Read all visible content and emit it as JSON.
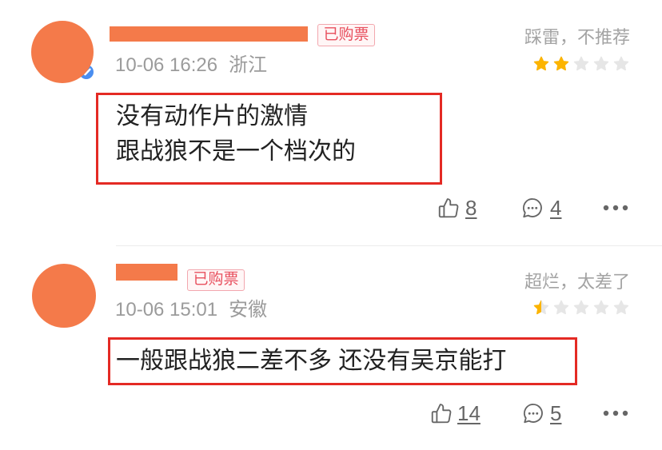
{
  "icons": {
    "verified": "verified-check-icon",
    "like": "thumbs-up-icon",
    "reply": "comment-bubble-icon",
    "more": "more-dots-icon",
    "star": "star-icon"
  },
  "colors": {
    "redaction": "#f47a4a",
    "highlight_border": "#e42a24",
    "badge_text": "#e8505e",
    "star_filled": "#fcb400",
    "star_empty": "#e6e6e6",
    "verified": "#4a8ef0",
    "muted_text": "#9b9b9b"
  },
  "comments": [
    {
      "verified": true,
      "badge": "已购票",
      "verdict": "踩雷，不推荐",
      "rating": 2,
      "rating_max": 5,
      "date": "10-06 16:26",
      "location": "浙江",
      "text_lines": [
        "没有动作片的激情",
        "跟战狼不是一个档次的"
      ],
      "likes": "8",
      "replies": "4"
    },
    {
      "verified": false,
      "badge": "已购票",
      "verdict": "超烂，太差了",
      "rating": 0.5,
      "rating_max": 5,
      "date": "10-06 15:01",
      "location": "安徽",
      "text_lines": [
        "一般跟战狼二差不多 还没有吴京能打"
      ],
      "likes": "14",
      "replies": "5"
    }
  ]
}
